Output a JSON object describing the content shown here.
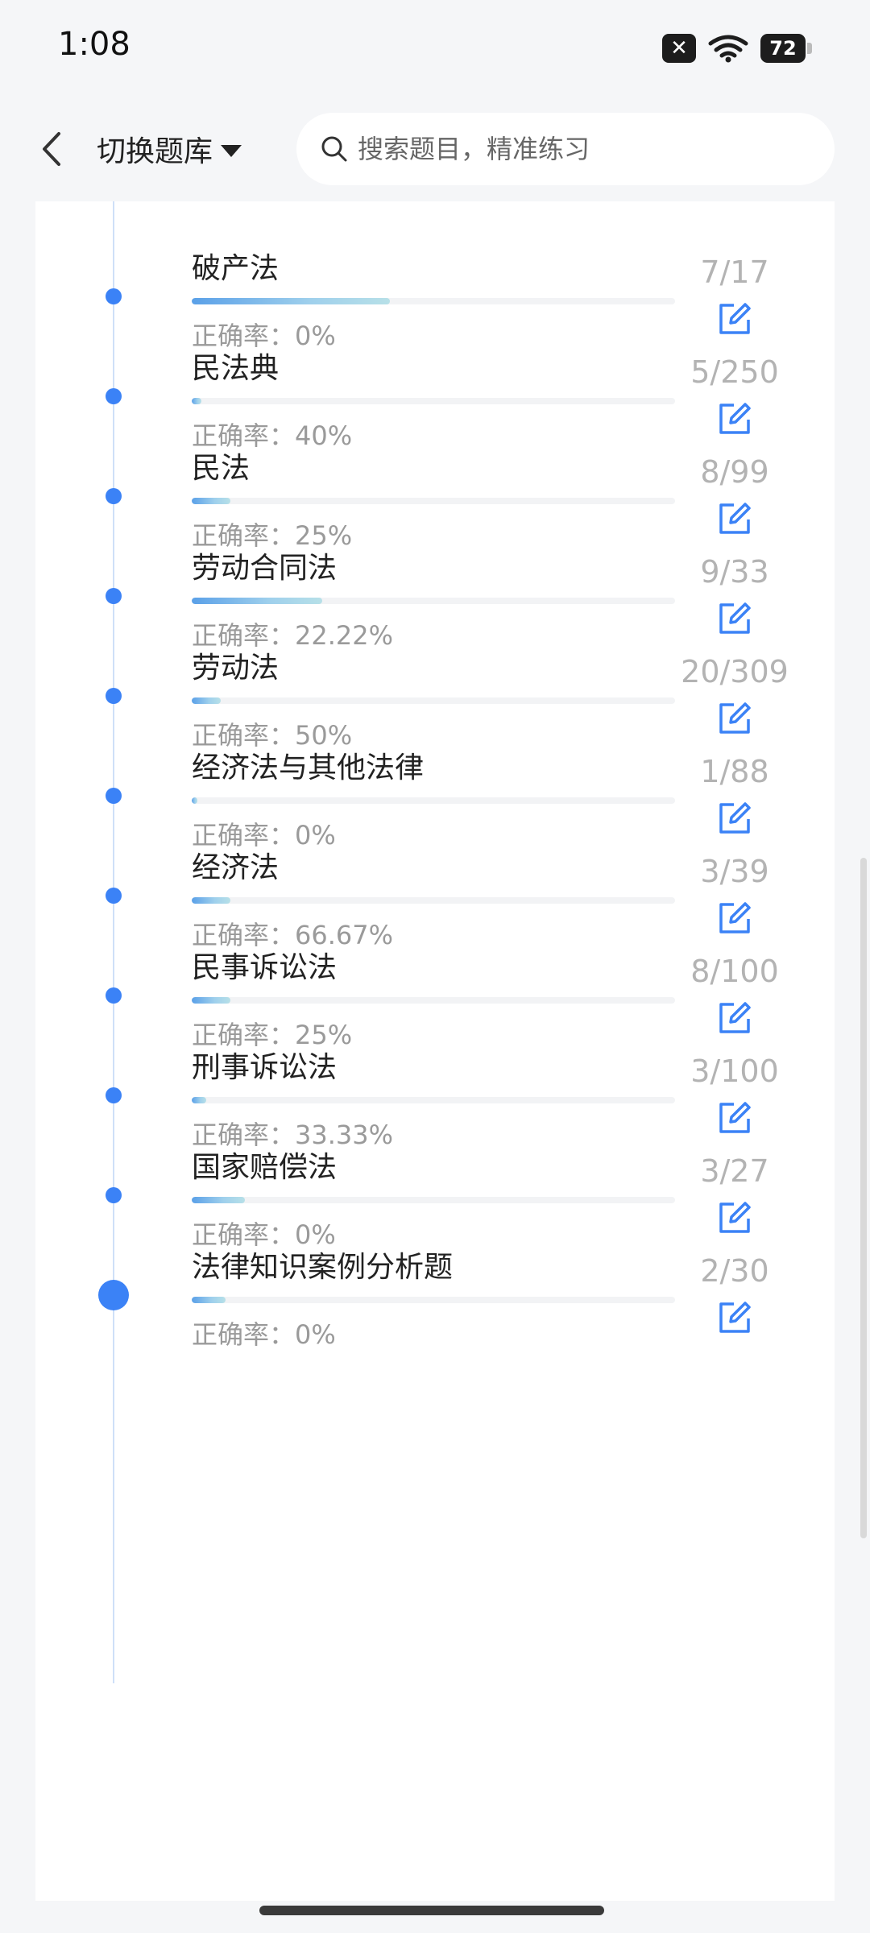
{
  "status_bar": {
    "time": "1:08",
    "sim_icon": "x-box-icon",
    "wifi_icon": "wifi-icon",
    "battery": "72"
  },
  "header": {
    "switch_label": "切换题库",
    "search_placeholder": "搜索题目，精准练习"
  },
  "colors": {
    "accent": "#3b82f6",
    "edit_icon": "#3b82f6"
  },
  "items": [
    {
      "title": "破产法",
      "accuracy": "正确率：0%",
      "count": "7/17",
      "progress": 0.41
    },
    {
      "title": "民法典",
      "accuracy": "正确率：40%",
      "count": "5/250",
      "progress": 0.02
    },
    {
      "title": "民法",
      "accuracy": "正确率：25%",
      "count": "8/99",
      "progress": 0.08
    },
    {
      "title": "劳动合同法",
      "accuracy": "正确率：22.22%",
      "count": "9/33",
      "progress": 0.27
    },
    {
      "title": "劳动法",
      "accuracy": "正确率：50%",
      "count": "20/309",
      "progress": 0.06
    },
    {
      "title": "经济法与其他法律",
      "accuracy": "正确率：0%",
      "count": "1/88",
      "progress": 0.01
    },
    {
      "title": "经济法",
      "accuracy": "正确率：66.67%",
      "count": "3/39",
      "progress": 0.08
    },
    {
      "title": "民事诉讼法",
      "accuracy": "正确率：25%",
      "count": "8/100",
      "progress": 0.08
    },
    {
      "title": "刑事诉讼法",
      "accuracy": "正确率：33.33%",
      "count": "3/100",
      "progress": 0.03
    },
    {
      "title": "国家赔偿法",
      "accuracy": "正确率：0%",
      "count": "3/27",
      "progress": 0.11
    },
    {
      "title": "法律知识案例分析题",
      "accuracy": "正确率：0%",
      "count": "2/30",
      "progress": 0.07
    }
  ]
}
